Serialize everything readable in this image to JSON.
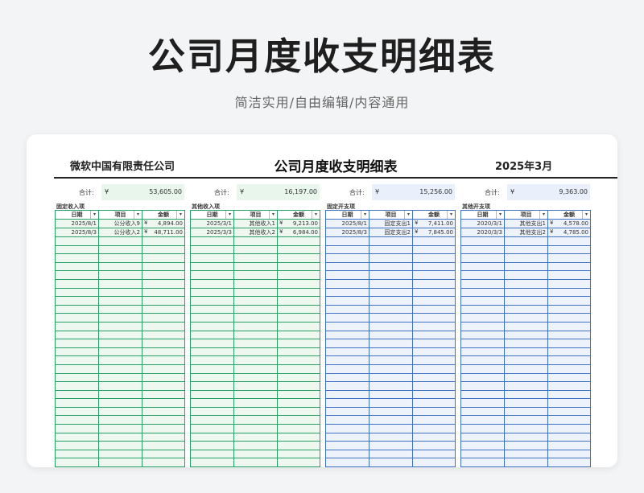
{
  "hero": {
    "title": "公司月度收支明细表",
    "subtitle": "简洁实用/自由编辑/内容通用"
  },
  "sheet": {
    "company": "微软中国有限责任公司",
    "title": "公司月度收支明细表",
    "period": "2025年3月"
  },
  "common": {
    "total_label": "合计:",
    "currency": "¥",
    "dropdown": "▾"
  },
  "columns": {
    "date": "日期",
    "item": "项目",
    "amount": "金额"
  },
  "colors": {
    "income": "#27a066",
    "expense": "#3f71c6"
  },
  "panels": [
    {
      "section": "固定收入项",
      "total": "53,605.00",
      "rows": [
        {
          "date": "2025/8/1",
          "item": "公分收入9",
          "amount": "4,894.00"
        },
        {
          "date": "2025/8/3",
          "item": "公分收入2",
          "amount": "48,711.00"
        }
      ]
    },
    {
      "section": "其他收入项",
      "total": "16,197.00",
      "rows": [
        {
          "date": "2025/3/1",
          "item": "其他收入1",
          "amount": "9,213.00"
        },
        {
          "date": "2025/3/3",
          "item": "其他收入2",
          "amount": "6,984.00"
        }
      ]
    },
    {
      "section": "固定开支项",
      "total": "15,256.00",
      "rows": [
        {
          "date": "2025/8/1",
          "item": "固定支出1",
          "amount": "7,411.00"
        },
        {
          "date": "2025/8/3",
          "item": "固定支出2",
          "amount": "7,845.00"
        }
      ]
    },
    {
      "section": "其他开支项",
      "total": "9,363.00",
      "rows": [
        {
          "date": "2020/3/1",
          "item": "其他支出1",
          "amount": "4,578.00"
        },
        {
          "date": "2020/3/3",
          "item": "其他支出2",
          "amount": "4,785.00"
        }
      ]
    }
  ]
}
